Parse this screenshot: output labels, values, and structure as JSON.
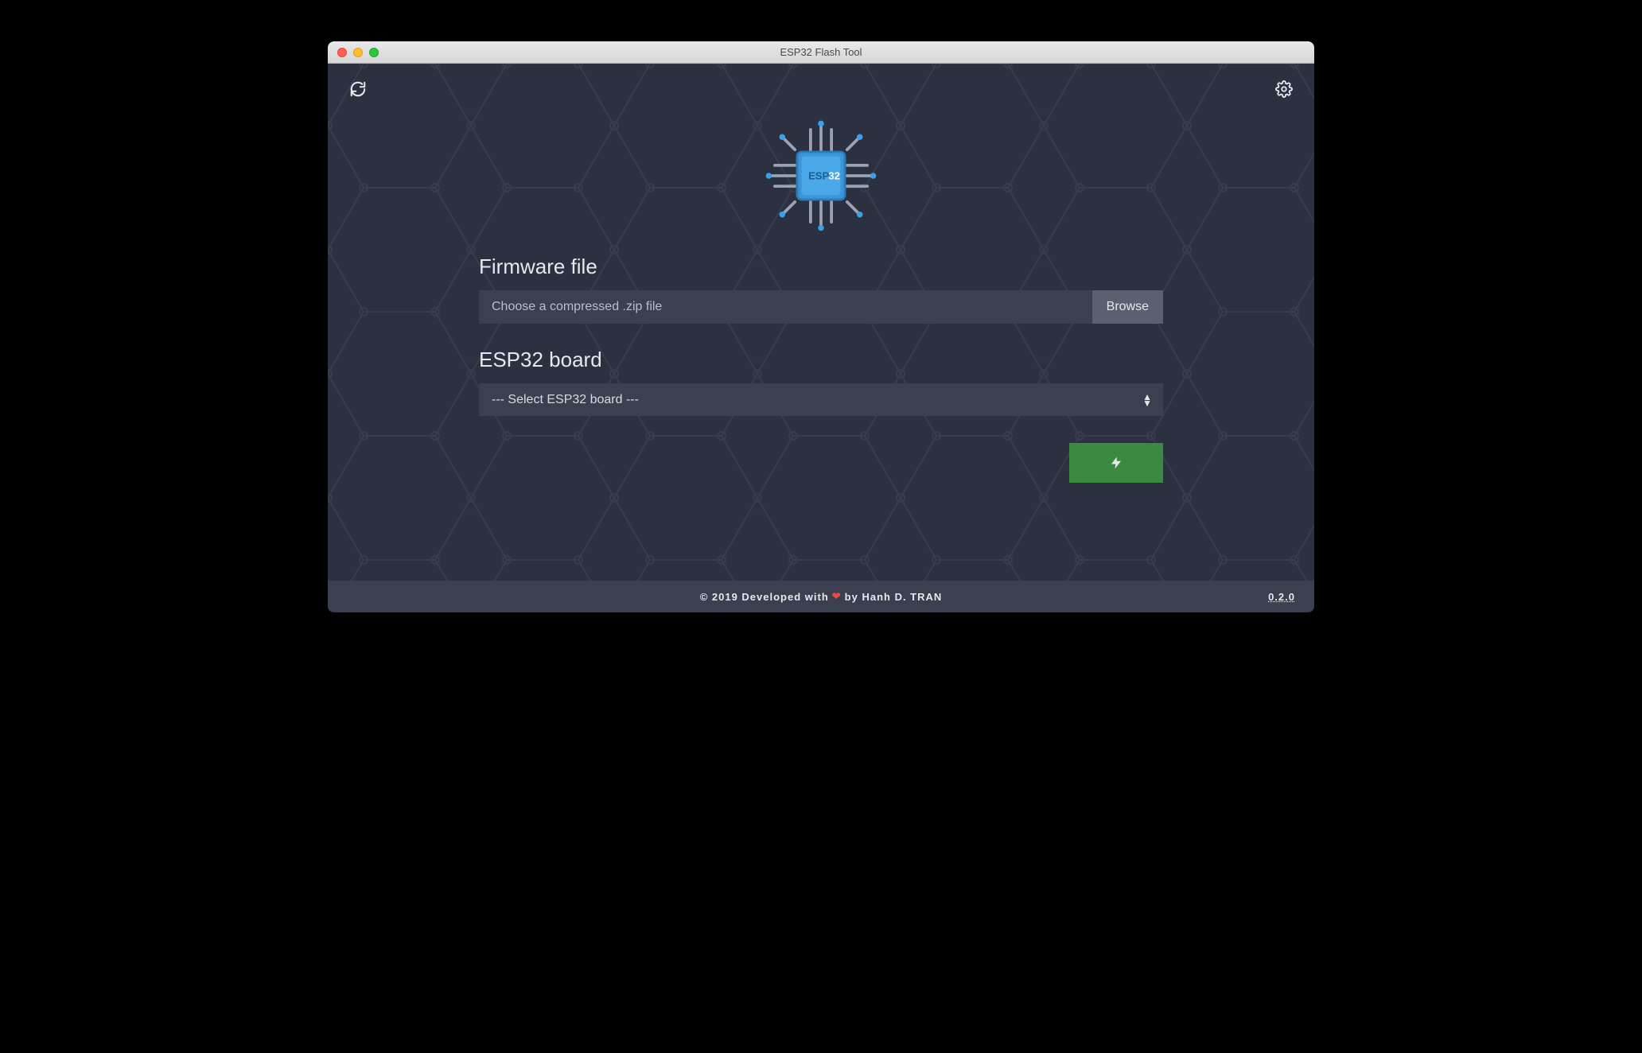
{
  "window": {
    "title": "ESP32 Flash Tool"
  },
  "logo": {
    "chip_text_left": "ESP",
    "chip_text_right": "32"
  },
  "form": {
    "firmware_label": "Firmware file",
    "firmware_placeholder": "Choose a compressed .zip file",
    "browse_label": "Browse",
    "board_label": "ESP32 board",
    "board_placeholder": "--- Select ESP32 board ---"
  },
  "footer": {
    "left": "© 2019 Developed with",
    "right": "by Hanh D. TRAN",
    "version": "0.2.0"
  }
}
